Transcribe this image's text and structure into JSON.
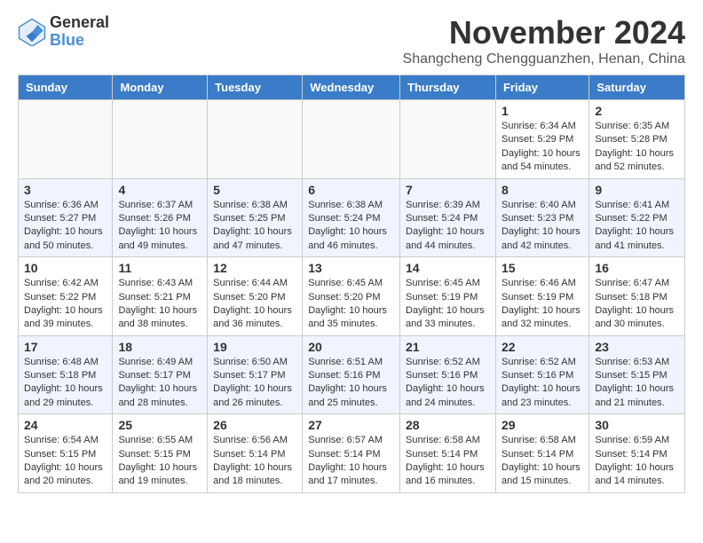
{
  "logo": {
    "general": "General",
    "blue": "Blue"
  },
  "title": "November 2024",
  "location": "Shangcheng Chengguanzhen, Henan, China",
  "days_of_week": [
    "Sunday",
    "Monday",
    "Tuesday",
    "Wednesday",
    "Thursday",
    "Friday",
    "Saturday"
  ],
  "weeks": [
    [
      {
        "day": "",
        "info": ""
      },
      {
        "day": "",
        "info": ""
      },
      {
        "day": "",
        "info": ""
      },
      {
        "day": "",
        "info": ""
      },
      {
        "day": "",
        "info": ""
      },
      {
        "day": "1",
        "info": "Sunrise: 6:34 AM\nSunset: 5:29 PM\nDaylight: 10 hours and 54 minutes."
      },
      {
        "day": "2",
        "info": "Sunrise: 6:35 AM\nSunset: 5:28 PM\nDaylight: 10 hours and 52 minutes."
      }
    ],
    [
      {
        "day": "3",
        "info": "Sunrise: 6:36 AM\nSunset: 5:27 PM\nDaylight: 10 hours and 50 minutes."
      },
      {
        "day": "4",
        "info": "Sunrise: 6:37 AM\nSunset: 5:26 PM\nDaylight: 10 hours and 49 minutes."
      },
      {
        "day": "5",
        "info": "Sunrise: 6:38 AM\nSunset: 5:25 PM\nDaylight: 10 hours and 47 minutes."
      },
      {
        "day": "6",
        "info": "Sunrise: 6:38 AM\nSunset: 5:24 PM\nDaylight: 10 hours and 46 minutes."
      },
      {
        "day": "7",
        "info": "Sunrise: 6:39 AM\nSunset: 5:24 PM\nDaylight: 10 hours and 44 minutes."
      },
      {
        "day": "8",
        "info": "Sunrise: 6:40 AM\nSunset: 5:23 PM\nDaylight: 10 hours and 42 minutes."
      },
      {
        "day": "9",
        "info": "Sunrise: 6:41 AM\nSunset: 5:22 PM\nDaylight: 10 hours and 41 minutes."
      }
    ],
    [
      {
        "day": "10",
        "info": "Sunrise: 6:42 AM\nSunset: 5:22 PM\nDaylight: 10 hours and 39 minutes."
      },
      {
        "day": "11",
        "info": "Sunrise: 6:43 AM\nSunset: 5:21 PM\nDaylight: 10 hours and 38 minutes."
      },
      {
        "day": "12",
        "info": "Sunrise: 6:44 AM\nSunset: 5:20 PM\nDaylight: 10 hours and 36 minutes."
      },
      {
        "day": "13",
        "info": "Sunrise: 6:45 AM\nSunset: 5:20 PM\nDaylight: 10 hours and 35 minutes."
      },
      {
        "day": "14",
        "info": "Sunrise: 6:45 AM\nSunset: 5:19 PM\nDaylight: 10 hours and 33 minutes."
      },
      {
        "day": "15",
        "info": "Sunrise: 6:46 AM\nSunset: 5:19 PM\nDaylight: 10 hours and 32 minutes."
      },
      {
        "day": "16",
        "info": "Sunrise: 6:47 AM\nSunset: 5:18 PM\nDaylight: 10 hours and 30 minutes."
      }
    ],
    [
      {
        "day": "17",
        "info": "Sunrise: 6:48 AM\nSunset: 5:18 PM\nDaylight: 10 hours and 29 minutes."
      },
      {
        "day": "18",
        "info": "Sunrise: 6:49 AM\nSunset: 5:17 PM\nDaylight: 10 hours and 28 minutes."
      },
      {
        "day": "19",
        "info": "Sunrise: 6:50 AM\nSunset: 5:17 PM\nDaylight: 10 hours and 26 minutes."
      },
      {
        "day": "20",
        "info": "Sunrise: 6:51 AM\nSunset: 5:16 PM\nDaylight: 10 hours and 25 minutes."
      },
      {
        "day": "21",
        "info": "Sunrise: 6:52 AM\nSunset: 5:16 PM\nDaylight: 10 hours and 24 minutes."
      },
      {
        "day": "22",
        "info": "Sunrise: 6:52 AM\nSunset: 5:16 PM\nDaylight: 10 hours and 23 minutes."
      },
      {
        "day": "23",
        "info": "Sunrise: 6:53 AM\nSunset: 5:15 PM\nDaylight: 10 hours and 21 minutes."
      }
    ],
    [
      {
        "day": "24",
        "info": "Sunrise: 6:54 AM\nSunset: 5:15 PM\nDaylight: 10 hours and 20 minutes."
      },
      {
        "day": "25",
        "info": "Sunrise: 6:55 AM\nSunset: 5:15 PM\nDaylight: 10 hours and 19 minutes."
      },
      {
        "day": "26",
        "info": "Sunrise: 6:56 AM\nSunset: 5:14 PM\nDaylight: 10 hours and 18 minutes."
      },
      {
        "day": "27",
        "info": "Sunrise: 6:57 AM\nSunset: 5:14 PM\nDaylight: 10 hours and 17 minutes."
      },
      {
        "day": "28",
        "info": "Sunrise: 6:58 AM\nSunset: 5:14 PM\nDaylight: 10 hours and 16 minutes."
      },
      {
        "day": "29",
        "info": "Sunrise: 6:58 AM\nSunset: 5:14 PM\nDaylight: 10 hours and 15 minutes."
      },
      {
        "day": "30",
        "info": "Sunrise: 6:59 AM\nSunset: 5:14 PM\nDaylight: 10 hours and 14 minutes."
      }
    ]
  ]
}
